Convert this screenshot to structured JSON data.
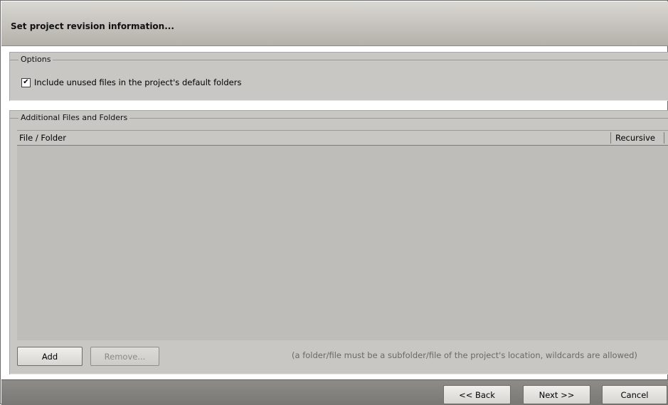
{
  "header": {
    "title": "Set project revision information..."
  },
  "options": {
    "legend": "Options",
    "include_unused": {
      "checked": true,
      "label": "Include unused files in the project's default folders"
    }
  },
  "files": {
    "legend": "Additional Files and Folders",
    "columns": [
      "File / Folder",
      "Recursive"
    ],
    "rows": [],
    "add_label": "Add",
    "remove_label": "Remove...",
    "hint": "(a folder/file must be a subfolder/file of the project's location, wildcards are allowed)"
  },
  "footer": {
    "back_label": "<< Back",
    "next_label": "Next >>",
    "cancel_label": "Cancel"
  }
}
